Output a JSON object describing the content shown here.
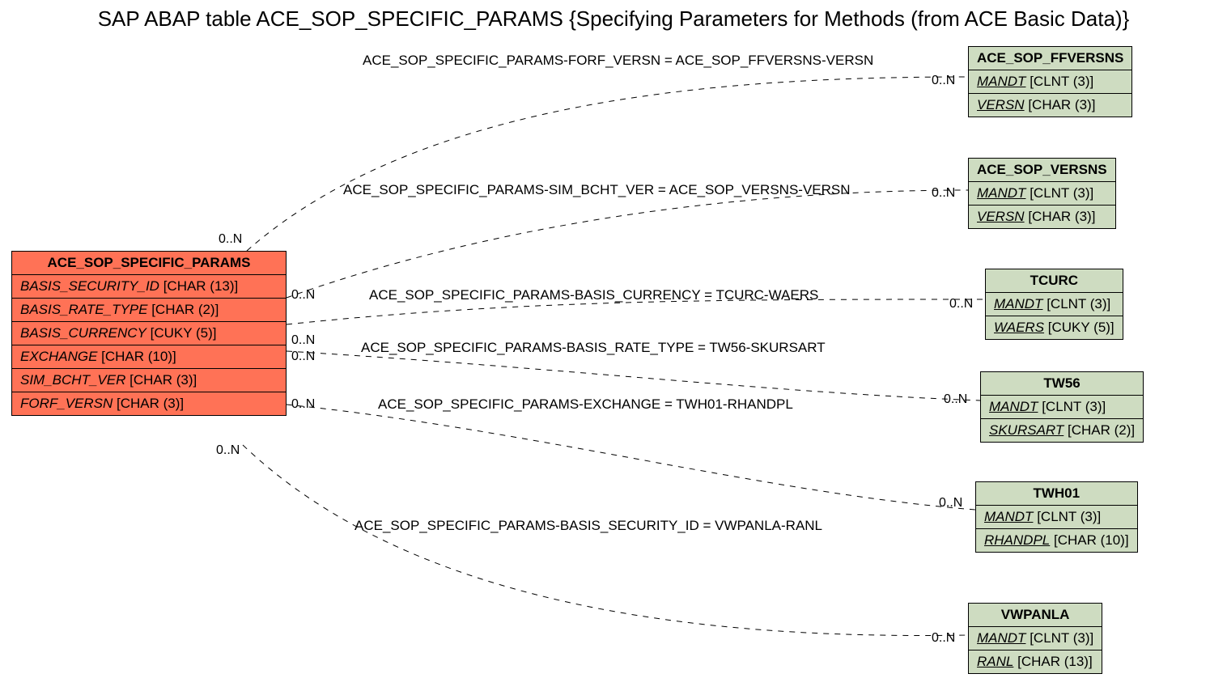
{
  "title": "SAP ABAP table ACE_SOP_SPECIFIC_PARAMS {Specifying Parameters for Methods (from ACE Basic Data)}",
  "mainTable": {
    "name": "ACE_SOP_SPECIFIC_PARAMS",
    "fields": [
      {
        "name": "BASIS_SECURITY_ID",
        "type": "[CHAR (13)]"
      },
      {
        "name": "BASIS_RATE_TYPE",
        "type": "[CHAR (2)]"
      },
      {
        "name": "BASIS_CURRENCY",
        "type": "[CUKY (5)]"
      },
      {
        "name": "EXCHANGE",
        "type": "[CHAR (10)]"
      },
      {
        "name": "SIM_BCHT_VER",
        "type": "[CHAR (3)]"
      },
      {
        "name": "FORF_VERSN",
        "type": "[CHAR (3)]"
      }
    ]
  },
  "refTables": [
    {
      "name": "ACE_SOP_FFVERSNS",
      "fields": [
        {
          "name": "MANDT",
          "type": "[CLNT (3)]"
        },
        {
          "name": "VERSN",
          "type": "[CHAR (3)]"
        }
      ]
    },
    {
      "name": "ACE_SOP_VERSNS",
      "fields": [
        {
          "name": "MANDT",
          "type": "[CLNT (3)]"
        },
        {
          "name": "VERSN",
          "type": "[CHAR (3)]"
        }
      ]
    },
    {
      "name": "TCURC",
      "fields": [
        {
          "name": "MANDT",
          "type": "[CLNT (3)]"
        },
        {
          "name": "WAERS",
          "type": "[CUKY (5)]"
        }
      ]
    },
    {
      "name": "TW56",
      "fields": [
        {
          "name": "MANDT",
          "type": "[CLNT (3)]"
        },
        {
          "name": "SKURSART",
          "type": "[CHAR (2)]"
        }
      ]
    },
    {
      "name": "TWH01",
      "fields": [
        {
          "name": "MANDT",
          "type": "[CLNT (3)]"
        },
        {
          "name": "RHANDPL",
          "type": "[CHAR (10)]"
        }
      ]
    },
    {
      "name": "VWPANLA",
      "fields": [
        {
          "name": "MANDT",
          "type": "[CLNT (3)]"
        },
        {
          "name": "RANL",
          "type": "[CHAR (13)]"
        }
      ]
    }
  ],
  "relations": [
    "ACE_SOP_SPECIFIC_PARAMS-FORF_VERSN = ACE_SOP_FFVERSNS-VERSN",
    "ACE_SOP_SPECIFIC_PARAMS-SIM_BCHT_VER = ACE_SOP_VERSNS-VERSN",
    "ACE_SOP_SPECIFIC_PARAMS-BASIS_CURRENCY = TCURC-WAERS",
    "ACE_SOP_SPECIFIC_PARAMS-BASIS_RATE_TYPE = TW56-SKURSART",
    "ACE_SOP_SPECIFIC_PARAMS-EXCHANGE = TWH01-RHANDPL",
    "ACE_SOP_SPECIFIC_PARAMS-BASIS_SECURITY_ID = VWPANLA-RANL"
  ],
  "cardinality": "0..N"
}
